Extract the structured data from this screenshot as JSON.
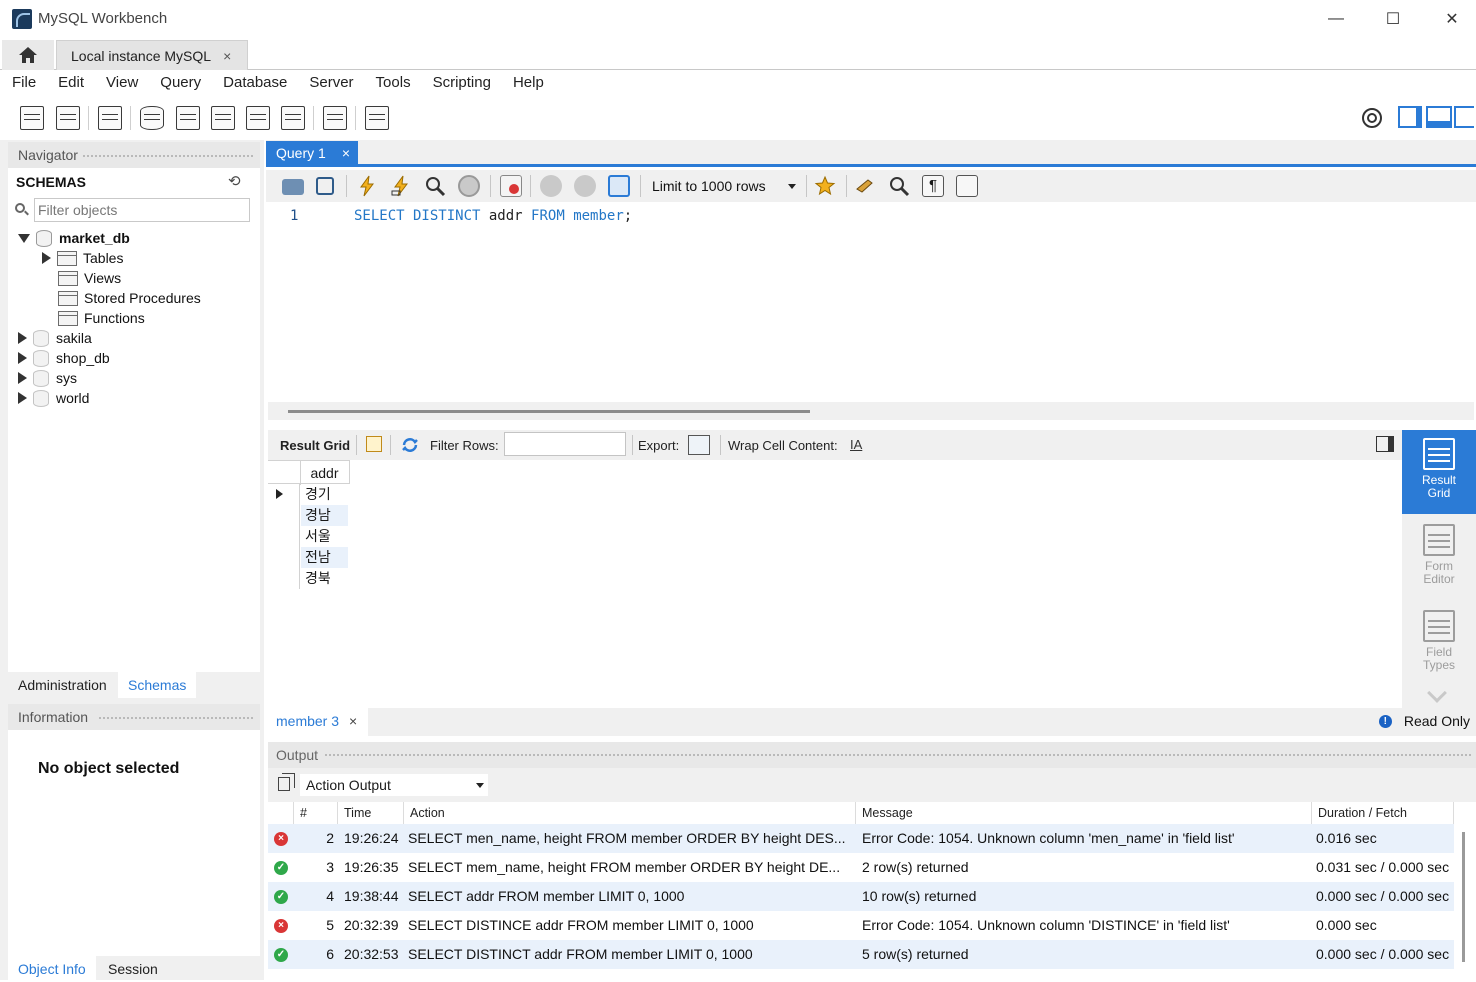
{
  "window": {
    "title": "MySQL Workbench",
    "minimize": "—",
    "maximize": "☐",
    "close": "✕"
  },
  "tabs": {
    "connection": "Local instance MySQL",
    "close": "×"
  },
  "menu": [
    "File",
    "Edit",
    "View",
    "Query",
    "Database",
    "Server",
    "Tools",
    "Scripting",
    "Help"
  ],
  "navigator": {
    "header": "Navigator",
    "schemas_label": "SCHEMAS",
    "filter_placeholder": "Filter objects",
    "tree": [
      {
        "label": "market_db",
        "expanded": true,
        "bold": true
      },
      {
        "label": "Tables",
        "child": true,
        "expandable": true
      },
      {
        "label": "Views",
        "child": true
      },
      {
        "label": "Stored Procedures",
        "child": true
      },
      {
        "label": "Functions",
        "child": true
      },
      {
        "label": "sakila"
      },
      {
        "label": "shop_db"
      },
      {
        "label": "sys"
      },
      {
        "label": "world"
      }
    ],
    "tab_admin": "Administration",
    "tab_schemas": "Schemas"
  },
  "information": {
    "header": "Information",
    "message": "No object selected",
    "tab_object_info": "Object Info",
    "tab_session": "Session"
  },
  "query": {
    "tab_label": "Query 1",
    "limit_label": "Limit to 1000 rows",
    "line_number": "1",
    "code": {
      "kw1": "SELECT DISTINCT",
      "col": "addr",
      "kw2": "FROM",
      "table": "member",
      "end": ";"
    }
  },
  "result_toolbar": {
    "result_grid": "Result Grid",
    "filter_rows": "Filter Rows:",
    "export": "Export:",
    "wrap": "Wrap Cell Content:"
  },
  "grid": {
    "column": "addr",
    "rows": [
      "경기",
      "경남",
      "서울",
      "전남",
      "경북"
    ]
  },
  "side_buttons": {
    "result_grid": "Result Grid",
    "form_editor": "Form Editor",
    "field_types": "Field Types"
  },
  "result_tab": {
    "label": "member 3",
    "read_only": "Read Only"
  },
  "output": {
    "header": "Output",
    "selector": "Action Output",
    "columns": {
      "num": "#",
      "time": "Time",
      "action": "Action",
      "message": "Message",
      "duration": "Duration / Fetch"
    },
    "rows": [
      {
        "status": "error",
        "num": "2",
        "time": "19:26:24",
        "action": "SELECT men_name, height    FROM member    ORDER BY height DES...",
        "message": "Error Code: 1054. Unknown column 'men_name' in 'field list'",
        "duration": "0.016 sec"
      },
      {
        "status": "ok",
        "num": "3",
        "time": "19:26:35",
        "action": "SELECT mem_name, height    FROM member    ORDER BY height DE...",
        "message": "2 row(s) returned",
        "duration": "0.031 sec / 0.000 sec"
      },
      {
        "status": "ok",
        "num": "4",
        "time": "19:38:44",
        "action": "SELECT addr FROM member LIMIT 0, 1000",
        "message": "10 row(s) returned",
        "duration": "0.000 sec / 0.000 sec"
      },
      {
        "status": "error",
        "num": "5",
        "time": "20:32:39",
        "action": "SELECT DISTINCE addr FROM member LIMIT 0, 1000",
        "message": "Error Code: 1054. Unknown column 'DISTINCE' in 'field list'",
        "duration": "0.000 sec"
      },
      {
        "status": "ok",
        "num": "6",
        "time": "20:32:53",
        "action": "SELECT DISTINCT addr FROM member LIMIT 0, 1000",
        "message": "5 row(s) returned",
        "duration": "0.000 sec / 0.000 sec"
      }
    ]
  },
  "colors": {
    "accent": "#2b7bd6",
    "error": "#d93636",
    "ok": "#2fa84a",
    "keyword": "#2377c7"
  }
}
